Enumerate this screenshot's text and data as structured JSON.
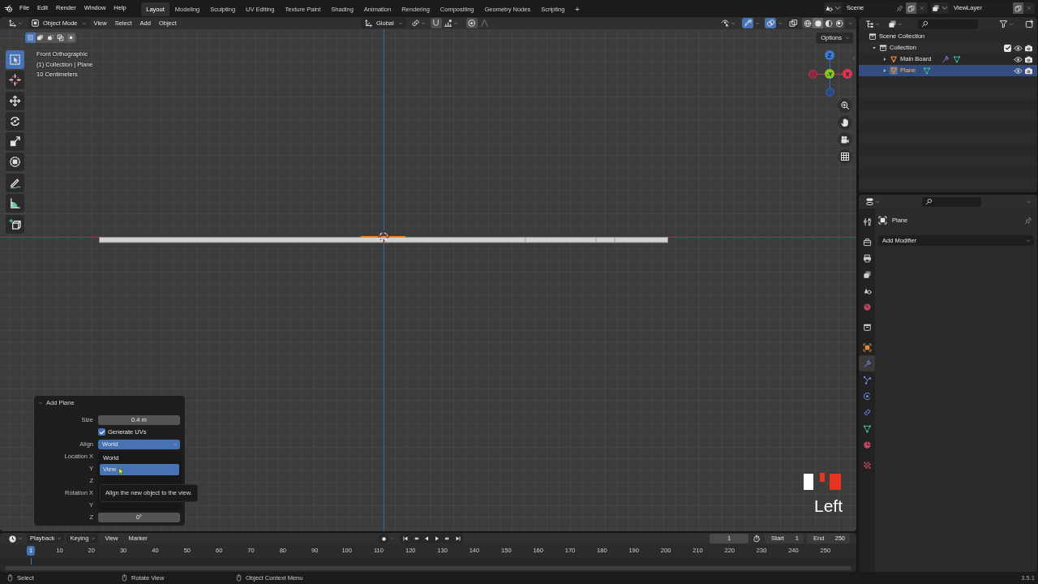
{
  "top_bar": {
    "menus": [
      "File",
      "Edit",
      "Render",
      "Window",
      "Help"
    ],
    "workspaces": [
      {
        "label": "Layout",
        "selected": true
      },
      {
        "label": "Modeling",
        "selected": false
      },
      {
        "label": "Sculpting",
        "selected": false
      },
      {
        "label": "UV Editing",
        "selected": false
      },
      {
        "label": "Texture Paint",
        "selected": false
      },
      {
        "label": "Shading",
        "selected": false
      },
      {
        "label": "Animation",
        "selected": false
      },
      {
        "label": "Rendering",
        "selected": false
      },
      {
        "label": "Compositing",
        "selected": false
      },
      {
        "label": "Geometry Nodes",
        "selected": false
      },
      {
        "label": "Scripting",
        "selected": false
      }
    ],
    "add_workspace": "+",
    "scene": "Scene",
    "view_layer": "ViewLayer"
  },
  "viewport": {
    "header": {
      "mode": "Object Mode",
      "menus": [
        "View",
        "Select",
        "Add",
        "Object"
      ],
      "orientation": "Global",
      "snap": {
        "on": false
      },
      "proportional_editing": {
        "on": false
      },
      "toggles": [
        {
          "kind": "gizmos",
          "on": true
        },
        {
          "kind": "overlays",
          "on": true
        },
        {
          "kind": "xray",
          "on": false
        }
      ],
      "shading": [
        {
          "kind": "wireframe",
          "selected": false
        },
        {
          "kind": "solid",
          "selected": true
        },
        {
          "kind": "material",
          "selected": false
        },
        {
          "kind": "rendered",
          "selected": false
        }
      ]
    },
    "select_modes": [
      {
        "kind": "set",
        "selected": true
      },
      {
        "kind": "extend",
        "selected": false
      },
      {
        "kind": "subtract",
        "selected": false
      },
      {
        "kind": "difference",
        "selected": false
      },
      {
        "kind": "intersect",
        "selected": false
      }
    ],
    "options": "Options",
    "info": [
      "Front Orthographic",
      "(1) Collection | Plane",
      "10 Centimeters"
    ],
    "tool_groups": [
      [
        {
          "kind": "select_box",
          "selected": true
        },
        {
          "kind": "cursor",
          "selected": false
        }
      ],
      [
        {
          "kind": "move",
          "selected": false
        },
        {
          "kind": "rotate",
          "selected": false
        },
        {
          "kind": "scale",
          "selected": false
        },
        {
          "kind": "transform",
          "selected": false
        }
      ],
      [
        {
          "kind": "annotate",
          "selected": false
        },
        {
          "kind": "measure",
          "selected": false
        }
      ],
      [
        {
          "kind": "add_cube",
          "selected": false
        }
      ]
    ],
    "gizmo_axes": [
      {
        "label": "Z",
        "color": "#3a7ad6"
      },
      {
        "label": "-Y",
        "color": "#86c81e"
      },
      {
        "label": "X",
        "color": "#de3458"
      }
    ],
    "redo_panel": {
      "title": "Add Plane",
      "expanded": true,
      "rows": [
        {
          "kind": "number",
          "label": "Size",
          "value": "0.4 m"
        },
        {
          "kind": "checkbox",
          "label": "Generate UVs",
          "checked": true
        },
        {
          "kind": "dropdown",
          "label": "Align",
          "value": "World",
          "open": true
        },
        {
          "kind": "label",
          "label": "Location X"
        },
        {
          "kind": "label",
          "label": "Y"
        },
        {
          "kind": "label",
          "label": "Z"
        },
        {
          "kind": "label",
          "label": "Rotation X"
        },
        {
          "kind": "label",
          "label": "Y"
        },
        {
          "kind": "number",
          "label": "Z",
          "value": "0°"
        }
      ],
      "menu": [
        {
          "label": "World",
          "selected": false
        },
        {
          "label": "View",
          "selected": true
        }
      ],
      "tooltip": "Align the new object to the view."
    },
    "screencast": {
      "key": "Left"
    }
  },
  "outliner": {
    "tree": [
      {
        "label": "Scene Collection",
        "kind": "scene",
        "selected": false,
        "children": [
          {
            "label": "Collection",
            "kind": "collection",
            "expanded": true,
            "checked": true,
            "selected": false,
            "children": [
              {
                "label": "Main Board",
                "kind": "mesh",
                "expanded": false,
                "modifier": true,
                "selected": false
              },
              {
                "label": "Plane",
                "kind": "mesh",
                "expanded": false,
                "modifier": false,
                "selected": true
              }
            ]
          }
        ]
      }
    ]
  },
  "properties": {
    "tab_groups": [
      [
        {
          "kind": "tool",
          "selected": false
        }
      ],
      [
        {
          "kind": "render",
          "selected": false
        },
        {
          "kind": "output",
          "selected": false
        },
        {
          "kind": "view_layer",
          "selected": false
        },
        {
          "kind": "scene",
          "selected": false
        },
        {
          "kind": "world",
          "selected": false
        }
      ],
      [
        {
          "kind": "collection",
          "selected": false
        }
      ],
      [
        {
          "kind": "object",
          "selected": false
        },
        {
          "kind": "modifiers",
          "selected": true
        },
        {
          "kind": "particles",
          "selected": false
        },
        {
          "kind": "physics",
          "selected": false
        },
        {
          "kind": "constraints",
          "selected": false
        },
        {
          "kind": "data",
          "selected": false
        },
        {
          "kind": "material",
          "selected": false
        }
      ],
      [
        {
          "kind": "texture",
          "selected": false
        }
      ]
    ],
    "object_name": "Plane",
    "add_modifier": "Add Modifier"
  },
  "timeline": {
    "menus": [
      {
        "label": "Playback",
        "dropdown": true
      },
      {
        "label": "Keying",
        "dropdown": true
      },
      {
        "label": "View",
        "dropdown": false
      },
      {
        "label": "Marker",
        "dropdown": false
      }
    ],
    "current_frame": "1",
    "start": {
      "label": "Start",
      "value": "1"
    },
    "end": {
      "label": "End",
      "value": "250"
    },
    "frames": [
      {
        "label": "1",
        "selected": true
      },
      {
        "label": "10",
        "selected": false
      },
      {
        "label": "20",
        "selected": false
      },
      {
        "label": "30",
        "selected": false
      },
      {
        "label": "40",
        "selected": false
      },
      {
        "label": "50",
        "selected": false
      },
      {
        "label": "60",
        "selected": false
      },
      {
        "label": "70",
        "selected": false
      },
      {
        "label": "80",
        "selected": false
      },
      {
        "label": "90",
        "selected": false
      },
      {
        "label": "100",
        "selected": false
      },
      {
        "label": "110",
        "selected": false
      },
      {
        "label": "120",
        "selected": false
      },
      {
        "label": "130",
        "selected": false
      },
      {
        "label": "140",
        "selected": false
      },
      {
        "label": "150",
        "selected": false
      },
      {
        "label": "160",
        "selected": false
      },
      {
        "label": "170",
        "selected": false
      },
      {
        "label": "180",
        "selected": false
      },
      {
        "label": "190",
        "selected": false
      },
      {
        "label": "200",
        "selected": false
      },
      {
        "label": "210",
        "selected": false
      },
      {
        "label": "220",
        "selected": false
      },
      {
        "label": "230",
        "selected": false
      },
      {
        "label": "240",
        "selected": false
      },
      {
        "label": "250",
        "selected": false
      }
    ]
  },
  "status_bar": {
    "hints": [
      "Select",
      "Rotate View",
      "Object Context Menu"
    ],
    "version": "3.5.1"
  }
}
